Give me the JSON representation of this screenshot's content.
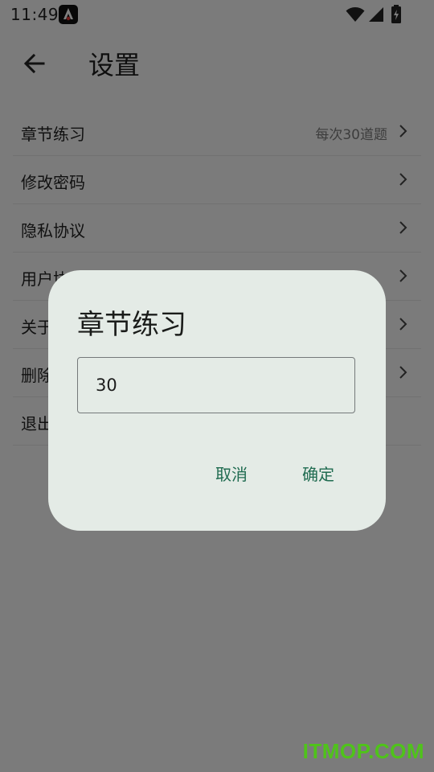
{
  "status_bar": {
    "time": "11:49",
    "icons": [
      "app-notification-icon",
      "wifi-icon",
      "cell-signal-icon",
      "battery-charging-icon"
    ]
  },
  "app_bar": {
    "back_icon": "arrow-left-icon",
    "title": "设置"
  },
  "settings": {
    "items": [
      {
        "label": "章节练习",
        "value": "每次30道题"
      },
      {
        "label": "修改密码",
        "value": ""
      },
      {
        "label": "隐私协议",
        "value": ""
      },
      {
        "label": "用户协议",
        "value": ""
      },
      {
        "label": "关于我们",
        "value": ""
      },
      {
        "label": "删除账号",
        "value": ""
      },
      {
        "label": "退出登录",
        "value": ""
      }
    ]
  },
  "dialog": {
    "title": "章节练习",
    "input_value": "30",
    "cancel_label": "取消",
    "confirm_label": "确定"
  },
  "watermark": "ITMOP.COM",
  "colors": {
    "dialog_bg": "#e4ebe6",
    "accent": "#1f6b50",
    "scrim": "rgba(0,0,0,0.5)",
    "watermark": "#4fc31a"
  }
}
